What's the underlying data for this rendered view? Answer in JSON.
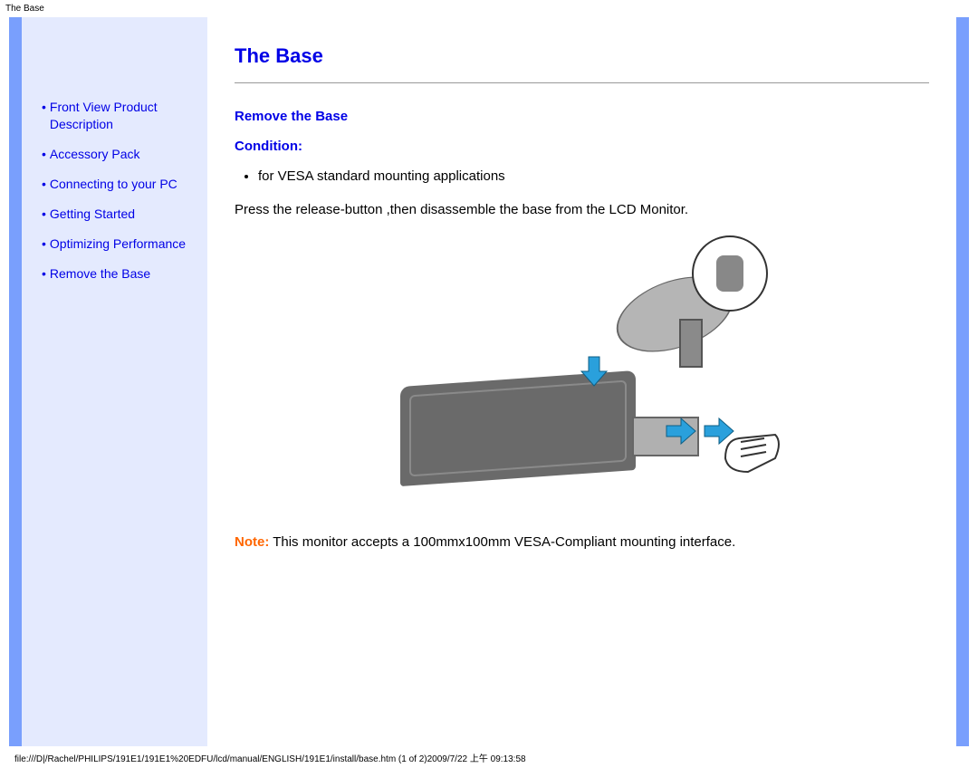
{
  "meta": {
    "top_title": "The Base"
  },
  "nav": {
    "items": [
      {
        "label": "Front View Product Description"
      },
      {
        "label": "Accessory Pack"
      },
      {
        "label": "Connecting to your PC"
      },
      {
        "label": "Getting Started"
      },
      {
        "label": "Optimizing Performance"
      },
      {
        "label": "Remove the Base"
      }
    ]
  },
  "content": {
    "heading": "The Base",
    "sub1": "Remove the Base",
    "condition_label": "Condition:",
    "condition_item": "for VESA standard mounting applications",
    "instruction": "Press the release-button ,then disassemble the base from the LCD Monitor.",
    "note_label": "Note:",
    "note_text": " This monitor accepts a 100mmx100mm VESA-Compliant mounting interface."
  },
  "footer": {
    "text": "file:///D|/Rachel/PHILIPS/191E1/191E1%20EDFU/lcd/manual/ENGLISH/191E1/install/base.htm (1 of 2)2009/7/22 上午 09:13:58"
  }
}
